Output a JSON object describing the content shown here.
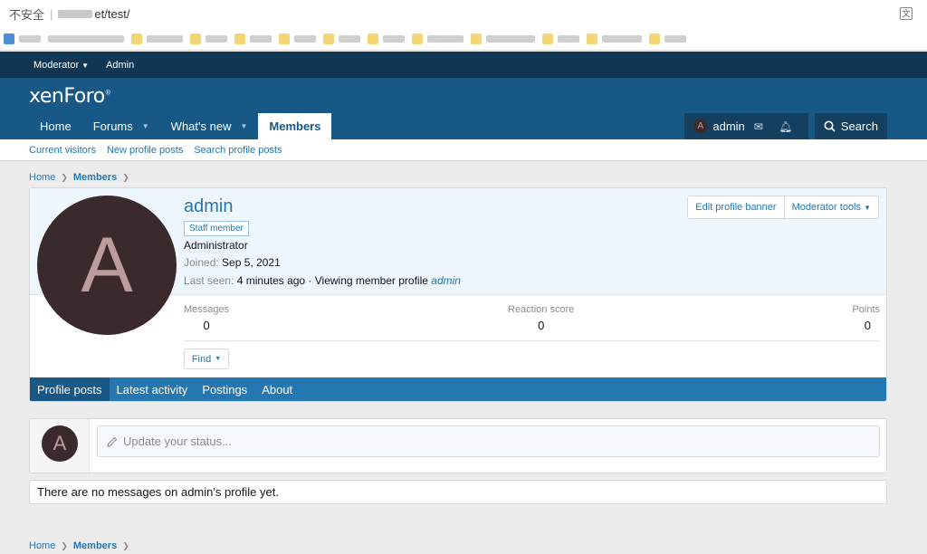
{
  "browser": {
    "security_text": "不安全",
    "url": "et/test/"
  },
  "staff_bar": {
    "moderator_label": "Moderator",
    "admin_label": "Admin"
  },
  "header": {
    "logo": "xenForo",
    "nav": [
      {
        "label": "Home"
      },
      {
        "label": "Forums"
      },
      {
        "label": "What's new"
      },
      {
        "label": "Members"
      }
    ],
    "user": {
      "avatar_letter": "A",
      "name": "admin"
    },
    "search_label": "Search"
  },
  "subnav": {
    "items": [
      "Current visitors",
      "New profile posts",
      "Search profile posts"
    ]
  },
  "breadcrumb": {
    "home": "Home",
    "members": "Members"
  },
  "profile": {
    "avatar_letter": "A",
    "name": "admin",
    "badge": "Staff member",
    "role": "Administrator",
    "joined_label": "Joined:",
    "joined_value": "Sep 5, 2021",
    "last_seen_label": "Last seen:",
    "last_seen_value": "4 minutes ago · Viewing member profile",
    "last_seen_link": "admin",
    "buttons": {
      "edit_banner": "Edit profile banner",
      "moderator_tools": "Moderator tools"
    },
    "stats": [
      {
        "label": "Messages",
        "value": "0"
      },
      {
        "label": "Reaction score",
        "value": "0"
      },
      {
        "label": "Points",
        "value": "0"
      }
    ],
    "find_label": "Find",
    "tabs": [
      "Profile posts",
      "Latest activity",
      "Postings",
      "About"
    ]
  },
  "status": {
    "avatar_letter": "A",
    "placeholder": "Update your status..."
  },
  "empty_message": "There are no messages on admin's profile yet.",
  "colors": {
    "header": "#185886",
    "staff_bar": "#0f3652",
    "link": "#2577b1",
    "avatar_bg": "#3a2a2b",
    "avatar_text": "#bd9c9e"
  }
}
